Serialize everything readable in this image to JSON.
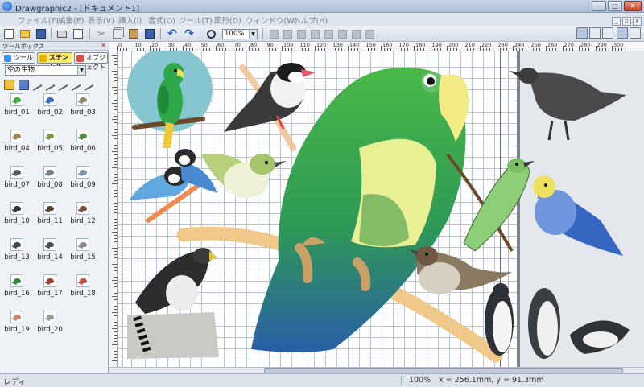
{
  "window": {
    "title": "Drawgraphic2 - [ドキュメント1]",
    "controls": {
      "minimize": "—",
      "maximize": "□",
      "close": "✕"
    }
  },
  "menu": [
    "ファイル(F)",
    "編集(E)",
    "表示(V)",
    "挿入(I)",
    "書式(O)",
    "ツール(T)",
    "図形(D)",
    "ウィンドウ(W)",
    "ヘルプ(H)"
  ],
  "toolbar": {
    "zoom_value": "100%",
    "icons": [
      "new-document-icon",
      "open-folder-icon",
      "save-icon",
      "print-icon",
      "print-preview-icon",
      "cut-icon",
      "copy-icon",
      "paste-icon",
      "paste-special-icon",
      "undo-icon",
      "redo-icon",
      "zoom-icon"
    ]
  },
  "toolbox": {
    "title": "ツールボックス",
    "close": "✕",
    "tabs": [
      {
        "label": "ツール",
        "color": "#3b8fe6"
      },
      {
        "label": "ステンシル",
        "color": "#e8b400",
        "active": true
      },
      {
        "label": "オブジェクト",
        "color": "#e54b3c"
      }
    ],
    "category": "空の生物",
    "stencils": [
      {
        "name": "bird_01",
        "color": "#3fae3a"
      },
      {
        "name": "bird_02",
        "color": "#3a6cc9"
      },
      {
        "name": "bird_03",
        "color": "#8a8a6e"
      },
      {
        "name": "bird_04",
        "color": "#a08b55"
      },
      {
        "name": "bird_05",
        "color": "#7c9a4c"
      },
      {
        "name": "bird_06",
        "color": "#4f8a3a"
      },
      {
        "name": "bird_07",
        "color": "#555a60"
      },
      {
        "name": "bird_08",
        "color": "#6f7f8f"
      },
      {
        "name": "bird_09",
        "color": "#7a8fa6"
      },
      {
        "name": "bird_10",
        "color": "#333333"
      },
      {
        "name": "bird_11",
        "color": "#5c4330"
      },
      {
        "name": "bird_12",
        "color": "#7a4e3a"
      },
      {
        "name": "bird_13",
        "color": "#444444"
      },
      {
        "name": "bird_14",
        "color": "#4d4d4d"
      },
      {
        "name": "bird_15",
        "color": "#8a8a8a"
      },
      {
        "name": "bird_16",
        "color": "#2f8a3a"
      },
      {
        "name": "bird_17",
        "color": "#a0412c"
      },
      {
        "name": "bird_18",
        "color": "#c74a3a"
      },
      {
        "name": "bird_19",
        "color": "#c98a6a"
      },
      {
        "name": "bird_20",
        "color": "#9a9a9a"
      }
    ]
  },
  "ruler": {
    "labels": [
      "0",
      "10",
      "20",
      "30",
      "40",
      "50",
      "60",
      "70",
      "80",
      "90",
      "100",
      "110",
      "120",
      "130",
      "140",
      "150",
      "160",
      "170",
      "180",
      "190",
      "200",
      "210",
      "220",
      "230",
      "240",
      "250",
      "260",
      "270",
      "280",
      "290",
      "300"
    ]
  },
  "status": {
    "ready": "レディ",
    "zoom": "100%",
    "coords": "x  =  256.1mm, y  =   91.3mm"
  },
  "colors": {
    "parrot_green": "#2fa84a",
    "parrot_light": "#9fd65a",
    "parrot_blue": "#2a5fa8",
    "beak_yellow": "#f3ec84",
    "branch": "#f0c98a",
    "grid": "#b5c3d6",
    "accent_tab": "#ffe96a"
  }
}
